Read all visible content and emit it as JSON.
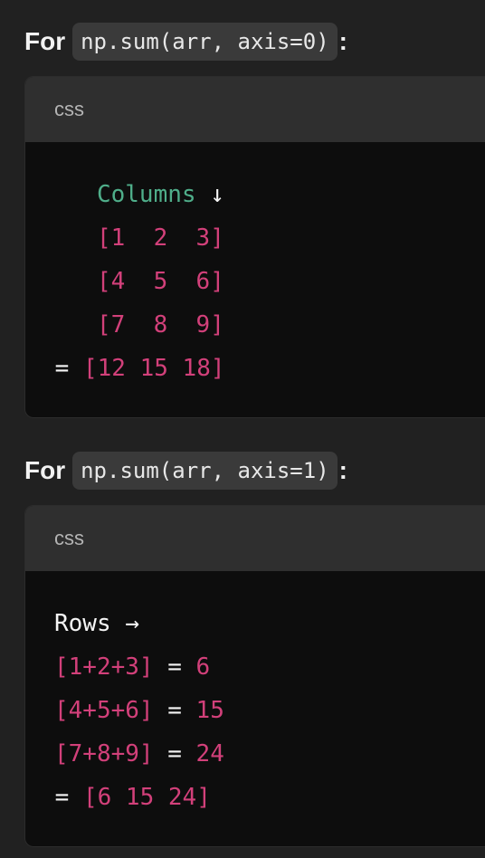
{
  "sections": [
    {
      "for_word": "For",
      "code": "np.sum(arr, axis=0)",
      "colon": ":",
      "lang": "css",
      "lines": [
        {
          "pre": "   ",
          "a": "Columns",
          "b": " ↓",
          "c": ""
        },
        {
          "pre": "   ",
          "a": "",
          "b": "",
          "c": "[1  2  3]"
        },
        {
          "pre": "   ",
          "a": "",
          "b": "",
          "c": "[4  5  6]"
        },
        {
          "pre": "   ",
          "a": "",
          "b": "",
          "c": "[7  8  9]"
        },
        {
          "pre": "",
          "a": "",
          "b": " = ",
          "c": "[12 15 18]"
        }
      ]
    },
    {
      "for_word": "For",
      "code": "np.sum(arr, axis=1)",
      "colon": ":",
      "lang": "css",
      "lines": [
        {
          "pre": "",
          "a": "",
          "b": "Rows →",
          "c": ""
        },
        {
          "pre": "",
          "a": "",
          "b": "",
          "c": "[1+2+3]",
          "d": " = ",
          "e": "6"
        },
        {
          "pre": "",
          "a": "",
          "b": "",
          "c": "[4+5+6]",
          "d": " = ",
          "e": "15"
        },
        {
          "pre": "",
          "a": "",
          "b": "",
          "c": "[7+8+9]",
          "d": " = ",
          "e": "24"
        },
        {
          "pre": "",
          "a": "",
          "b": " = ",
          "c": "[6 15 24]"
        }
      ]
    }
  ]
}
